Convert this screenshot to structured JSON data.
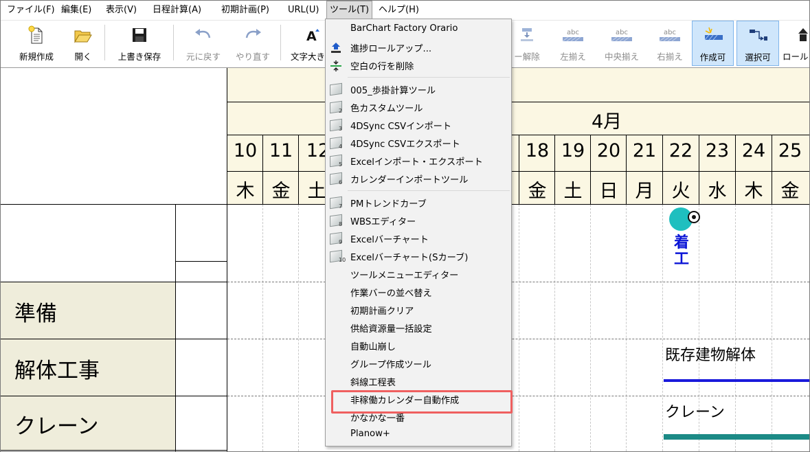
{
  "menubar": {
    "items": [
      {
        "label": "ファイル(F)"
      },
      {
        "label": "編集(E)"
      },
      {
        "label": "表示(V)"
      },
      {
        "label": "日程計算(A)"
      },
      {
        "label": "初期計画(P)"
      },
      {
        "label": "URL(U)"
      },
      {
        "label": "ツール(T)"
      },
      {
        "label": "ヘルプ(H)"
      }
    ]
  },
  "toolbar": {
    "new": "新規作成",
    "open": "開く",
    "save": "上書き保存",
    "undo": "元に戻す",
    "redo": "やり直す",
    "font_size": "文字大き",
    "unlink": "ー解除",
    "align_left": "左揃え",
    "align_center": "中央揃え",
    "align_right": "右揃え",
    "create_enabled": "作成可",
    "select_enabled": "選択可",
    "roll": "ロール",
    "abc": "abc"
  },
  "tools_menu": {
    "items": [
      {
        "label": "BarChart Factory Orario"
      },
      {
        "label": "進捗ロールアップ..."
      },
      {
        "label": "空白の行を削除"
      },
      {
        "label": "005_歩掛計算ツール",
        "num": ""
      },
      {
        "label": "色カスタムツール",
        "num": "2"
      },
      {
        "label": "4DSync CSVインポート",
        "num": "3"
      },
      {
        "label": "4DSync CSVエクスポート",
        "num": "4"
      },
      {
        "label": "Excelインポート・エクスポート",
        "num": "5"
      },
      {
        "label": "カレンダーインポートツール",
        "num": "6"
      },
      {
        "label": "PMトレンドカーブ",
        "num": "7"
      },
      {
        "label": "WBSエディター",
        "num": "8"
      },
      {
        "label": "Excelバーチャート",
        "num": "9"
      },
      {
        "label": "Excelバーチャート(Sカーブ)",
        "num": "10"
      },
      {
        "label": "ツールメニューエディター"
      },
      {
        "label": "作業バーの並べ替え"
      },
      {
        "label": "初期計画クリア"
      },
      {
        "label": "供給資源量一括設定"
      },
      {
        "label": "自動山崩し"
      },
      {
        "label": "グループ作成ツール"
      },
      {
        "label": "斜線工程表"
      },
      {
        "label": "非稼働カレンダー自動作成"
      },
      {
        "label": "かなかな一番"
      },
      {
        "label": "Planow+"
      }
    ]
  },
  "calendar": {
    "month": "4月",
    "days_left": [
      {
        "num": "10",
        "name": "木"
      },
      {
        "num": "11",
        "name": "金"
      },
      {
        "num": "12",
        "name": "土"
      }
    ],
    "days_right": [
      {
        "num": "18",
        "name": "金"
      },
      {
        "num": "19",
        "name": "土"
      },
      {
        "num": "20",
        "name": "日"
      },
      {
        "num": "21",
        "name": "月"
      },
      {
        "num": "22",
        "name": "火"
      },
      {
        "num": "23",
        "name": "水"
      },
      {
        "num": "24",
        "name": "木"
      },
      {
        "num": "25",
        "name": "金"
      }
    ]
  },
  "rows": [
    {
      "label": "準備"
    },
    {
      "label": "解体工事"
    },
    {
      "label": "クレーン"
    }
  ],
  "chart": {
    "milestone_label": "着工",
    "bar1_label": "既存建物解体",
    "bar2_label": "クレーン",
    "colors": {
      "milestone": "#1fbfbf",
      "bar1": "#1a1adb",
      "bar2": "#1c8a86",
      "highlight": "#ef5f5f"
    }
  }
}
